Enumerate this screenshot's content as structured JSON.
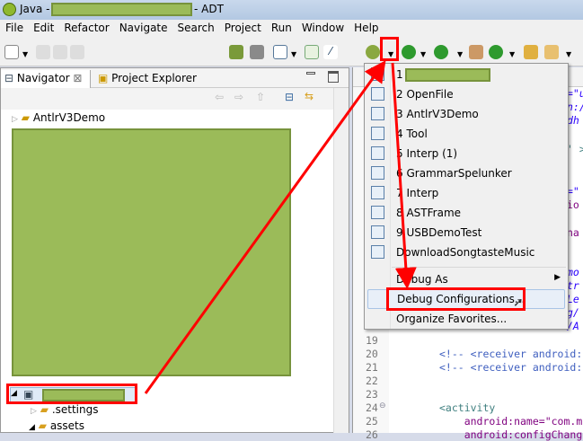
{
  "window": {
    "title_prefix": "Java - ",
    "title_suffix": "- ADT"
  },
  "menubar": [
    "File",
    "Edit",
    "Refactor",
    "Navigate",
    "Search",
    "Project",
    "Run",
    "Window",
    "Help"
  ],
  "navigator": {
    "tabs": [
      {
        "label": "Navigator",
        "icon": "navigator-icon",
        "active": true
      },
      {
        "label": "Project Explorer",
        "icon": "folder-icon"
      }
    ],
    "items": [
      {
        "label": "AntlrV3Demo"
      },
      {
        "label": ".settings"
      },
      {
        "label": "assets"
      }
    ]
  },
  "debug_menu": {
    "history": [
      {
        "num": "1",
        "label": "",
        "type": "android"
      },
      {
        "num": "2",
        "label": "OpenFile",
        "type": "android"
      },
      {
        "num": "3",
        "label": "AntlrV3Demo",
        "type": "android"
      },
      {
        "num": "4",
        "label": "Tool",
        "type": "java"
      },
      {
        "num": "5",
        "label": "Interp (1)",
        "type": "java"
      },
      {
        "num": "6",
        "label": "GrammarSpelunker",
        "type": "java"
      },
      {
        "num": "7",
        "label": "Interp",
        "type": "java"
      },
      {
        "num": "8",
        "label": "ASTFrame",
        "type": "java"
      },
      {
        "num": "9",
        "label": "USBDemoTest",
        "type": "java"
      },
      {
        "num": "",
        "label": "DownloadSongtasteMusic",
        "type": "android"
      }
    ],
    "debug_as": "Debug As",
    "debug_configurations": "Debug Configurations...",
    "organize_favorites": "Organize Favorites..."
  },
  "editor": {
    "fragments": [
      "=\"u",
      "n:/",
      "dh",
      "' >",
      "=\"",
      "io",
      "na",
      "mo",
      "tr",
      "Le",
      "g/",
      "/A"
    ],
    "lines": [
      {
        "n": "19",
        "code": ""
      },
      {
        "n": "20",
        "code": "<!-- <receiver android:"
      },
      {
        "n": "21",
        "code": "<!-- <receiver android:"
      },
      {
        "n": "22",
        "code": ""
      },
      {
        "n": "23",
        "code": ""
      },
      {
        "n": "24",
        "code": "<activity"
      },
      {
        "n": "25",
        "code": "    android:name=\"com.m"
      },
      {
        "n": "26",
        "code": "    android:configChange"
      }
    ]
  },
  "colors": {
    "annotation": "#ff0000",
    "redacted": "#9bbb59"
  }
}
